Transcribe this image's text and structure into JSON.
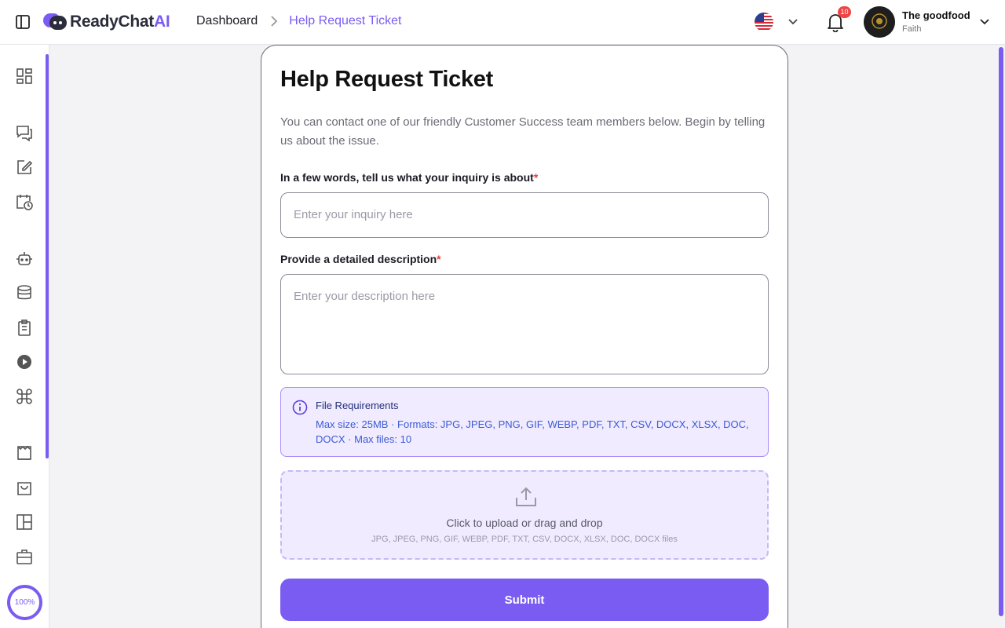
{
  "app": {
    "brand_main": "ReadyChat",
    "brand_accent": "AI",
    "accent_color": "#7b5cf2"
  },
  "header": {
    "breadcrumb_home": "Dashboard",
    "breadcrumb_current": "Help Request Ticket",
    "notification_count": "10",
    "user_name": "The goodfood",
    "user_role": "Faith",
    "language_flag": "us-flag-icon"
  },
  "sidebar": {
    "icons": [
      "dashboard-grid-icon",
      "chat-icon",
      "edit-icon",
      "calendar-clock-icon",
      "bot-icon",
      "database-icon",
      "clipboard-icon",
      "play-icon",
      "command-icon",
      "ticket-icon",
      "shopping-bag-icon",
      "layout-icon",
      "briefcase-icon"
    ],
    "zoom_label": "100%"
  },
  "form": {
    "title": "Help Request Ticket",
    "intro": "You can contact one of our friendly Customer Success team members below. Begin by telling us about the issue.",
    "inquiry_label": "In a few words, tell us what your inquiry is about",
    "inquiry_placeholder": "Enter your inquiry here",
    "description_label": "Provide a detailed description",
    "description_placeholder": "Enter your description here",
    "required_mark": "*",
    "file_req_title": "File Requirements",
    "file_req_text": "Max size: 25MB · Formats: JPG, JPEG, PNG, GIF, WEBP, PDF, TXT, CSV, DOCX, XLSX, DOC, DOCX · Max files: 10",
    "upload_main": "Click to upload or drag and drop",
    "upload_sub": "JPG, JPEG, PNG, GIF, WEBP, PDF, TXT, CSV, DOCX, XLSX, DOC, DOCX files",
    "submit_label": "Submit"
  }
}
